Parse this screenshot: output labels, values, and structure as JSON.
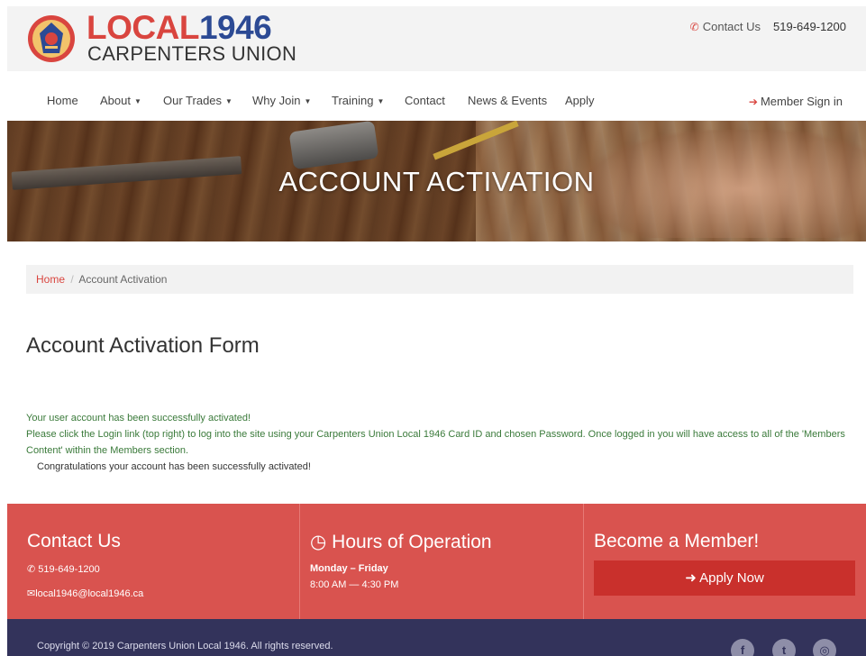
{
  "header": {
    "logo_local": "LOCAL",
    "logo_number": "1946",
    "logo_subtitle": "CARPENTERS UNION",
    "contact_label": "Contact Us",
    "phone": "519-649-1200"
  },
  "nav": {
    "items": [
      {
        "label": "Home",
        "dropdown": false
      },
      {
        "label": "About",
        "dropdown": true
      },
      {
        "label": "Our Trades",
        "dropdown": true
      },
      {
        "label": "Why Join",
        "dropdown": true
      },
      {
        "label": "Training",
        "dropdown": true
      },
      {
        "label": "Contact",
        "dropdown": false
      },
      {
        "label": "News & Events",
        "dropdown": false
      },
      {
        "label": "Apply",
        "dropdown": false
      }
    ],
    "caret": "▼",
    "member_signin": "Member Sign in"
  },
  "hero": {
    "title": "ACCOUNT ACTIVATION"
  },
  "breadcrumb": {
    "home": "Home",
    "separator": "/",
    "current": "Account Activation"
  },
  "main": {
    "title": "Account Activation Form",
    "line1": "Your user account has been successfully activated!",
    "line2": "Please click the Login link (top right) to log into the site using your Carpenters Union Local 1946 Card ID and chosen Password. Once logged in you will have access to all of the 'Members Content' within the Members section.",
    "line3": "Congratulations your account has been successfully activated!"
  },
  "footer": {
    "contact_heading": "Contact Us",
    "contact_phone": "519-649-1200",
    "contact_email": "local1946@local1946.ca",
    "hours_heading": "Hours of Operation",
    "hours_days": "Monday – Friday",
    "hours_time": "8:00 AM — 4:30 PM",
    "member_heading": "Become a Member!",
    "apply_label": "Apply Now",
    "copyright": "Copyright © 2019 Carpenters Union Local 1946. All rights reserved.",
    "social": [
      "f",
      "t",
      "◎"
    ]
  },
  "colors": {
    "brand_red": "#d9453f",
    "brand_blue": "#2c4a94",
    "footer_red": "#d9534f",
    "footer_dark": "#33335b",
    "success_green": "#3a7a3a"
  },
  "icons": {
    "phone": "phone-icon",
    "signin": "sign-in-icon",
    "clock": "clock-icon",
    "email": "envelope-icon",
    "arrow": "arrow-circle-right-icon"
  }
}
